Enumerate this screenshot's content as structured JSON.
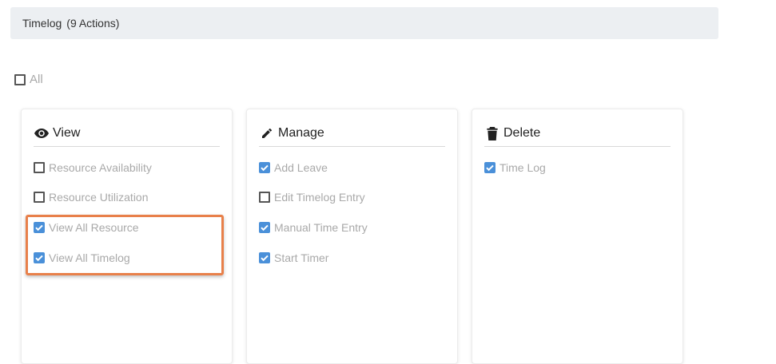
{
  "section": {
    "title": "Timelog",
    "count_label": "(9 Actions)"
  },
  "select_all": {
    "label": "All",
    "checked": false
  },
  "groups": [
    {
      "title": "View",
      "icon": "eye-icon",
      "items": [
        {
          "label": "Resource Availability",
          "checked": false
        },
        {
          "label": "Resource Utilization",
          "checked": false
        },
        {
          "label": "View All Resource",
          "checked": true
        },
        {
          "label": "View All Timelog",
          "checked": true
        }
      ]
    },
    {
      "title": "Manage",
      "icon": "pencil-icon",
      "items": [
        {
          "label": "Add Leave",
          "checked": true
        },
        {
          "label": "Edit Timelog Entry",
          "checked": false
        },
        {
          "label": "Manual Time Entry",
          "checked": true
        },
        {
          "label": "Start Timer",
          "checked": true
        }
      ]
    },
    {
      "title": "Delete",
      "icon": "trash-icon",
      "items": [
        {
          "label": "Time Log",
          "checked": true
        }
      ]
    }
  ],
  "colors": {
    "header_bg": "#eceff2",
    "checkbox_checked": "#4a90d9",
    "highlight": "#e8804a",
    "muted_text": "#a9a9a9"
  }
}
